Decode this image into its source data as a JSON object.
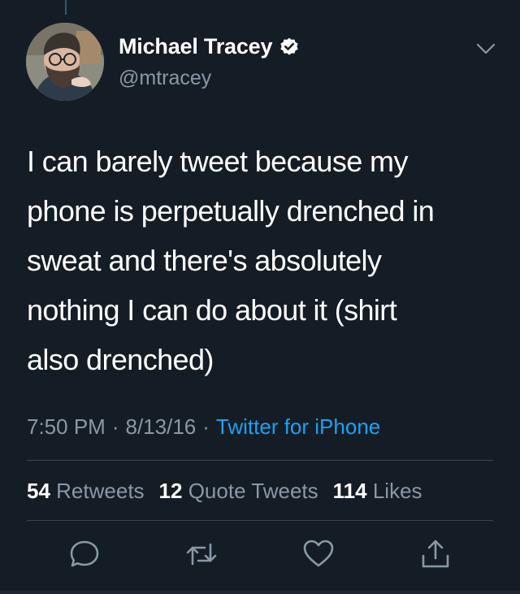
{
  "tweet": {
    "author": {
      "display_name": "Michael Tracey",
      "handle": "@mtracey",
      "verified": true
    },
    "text": "I can barely tweet because my phone is perpetually drenched in sweat and there's absolutely nothing I can do about it (shirt also drenched)",
    "text_lines": [
      "I can barely tweet because my",
      "phone is perpetually drenched in",
      "sweat and there's absolutely",
      "nothing I can do about it (shirt",
      "also drenched)"
    ],
    "time": "7:50 PM",
    "date": "8/13/16",
    "separator": "·",
    "source": "Twitter for iPhone",
    "stats": {
      "retweets_count": "54",
      "retweets_label": "Retweets",
      "quote_tweets_count": "12",
      "quote_tweets_label": "Quote Tweets",
      "likes_count": "114",
      "likes_label": "Likes"
    }
  },
  "icons": {
    "more": "chevron-down-icon",
    "reply": "reply-icon",
    "retweet": "retweet-icon",
    "like": "heart-icon",
    "share": "share-icon",
    "verified": "verified-badge-icon"
  },
  "colors": {
    "background": "#141d26",
    "text_primary": "#ffffff",
    "text_secondary": "#8899a6",
    "link": "#1da1f2",
    "divider": "#38444d"
  }
}
